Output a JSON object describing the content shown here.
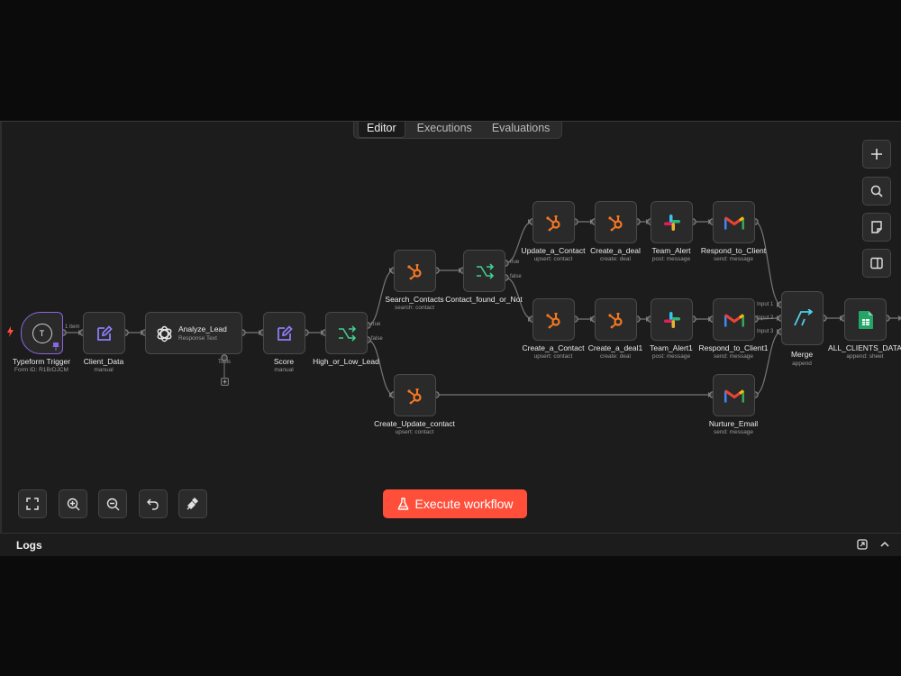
{
  "tabs": [
    "Editor",
    "Executions",
    "Evaluations"
  ],
  "active_tab": "Editor",
  "execute_label": "Execute workflow",
  "logs_title": "Logs",
  "conn_labels": {
    "items": "1 item",
    "tools": "Tools",
    "true1": "true",
    "false1": "false",
    "true2": "true",
    "false2": "false",
    "in1": "Input 1",
    "in2": "Input 2",
    "in3": "Input 3"
  },
  "nodes": {
    "typeform": {
      "label": "Typeform Trigger",
      "sub": "Form ID: R1BrDJCM",
      "icon": "typeform-icon",
      "letter": "T"
    },
    "client_data": {
      "label": "Client_Data",
      "sub": "manual",
      "icon": "edit-icon"
    },
    "analyze": {
      "label": "Analyze_Lead",
      "sub": "Response Text",
      "icon": "openai-icon"
    },
    "score": {
      "label": "Score",
      "sub": "manual",
      "icon": "edit-icon"
    },
    "high_low": {
      "label": "High_or_Low_Lead",
      "sub": "",
      "icon": "switch-icon"
    },
    "search": {
      "label": "Search_Contacts",
      "sub": "search: contact",
      "icon": "hubspot-icon"
    },
    "contact_found": {
      "label": "Contact_found_or_Not",
      "sub": "",
      "icon": "switch-icon"
    },
    "update": {
      "label": "Update_a_Contact",
      "sub": "upsert: contact",
      "icon": "hubspot-icon"
    },
    "deal": {
      "label": "Create_a_deal",
      "sub": "create: deal",
      "icon": "hubspot-icon"
    },
    "team_alert": {
      "label": "Team_Alert",
      "sub": "post: message",
      "icon": "slack-icon"
    },
    "respond": {
      "label": "Respond_to_Client",
      "sub": "send: message",
      "icon": "gmail-icon"
    },
    "create_contact": {
      "label": "Create_a_Contact",
      "sub": "upsert: contact",
      "icon": "hubspot-icon"
    },
    "deal1": {
      "label": "Create_a_deal1",
      "sub": "create: deal",
      "icon": "hubspot-icon"
    },
    "team_alert1": {
      "label": "Team_Alert1",
      "sub": "post: message",
      "icon": "slack-icon"
    },
    "respond1": {
      "label": "Respond_to_Client1",
      "sub": "send: message",
      "icon": "gmail-icon"
    },
    "merge": {
      "label": "Merge",
      "sub": "append",
      "icon": "merge-icon"
    },
    "sheets": {
      "label": "ALL_CLIENTS_DATA",
      "sub": "append: sheet",
      "icon": "google-sheets-icon"
    },
    "create_update": {
      "label": "Create_Update_contact",
      "sub": "upsert: contact",
      "icon": "hubspot-icon"
    },
    "nurture": {
      "label": "Nurture_Email",
      "sub": "send: message",
      "icon": "gmail-icon"
    }
  },
  "side_controls": [
    "plus-icon",
    "search-icon",
    "sticky-note-icon",
    "panel-icon"
  ],
  "bottom_controls": [
    "fit-view-icon",
    "zoom-in-icon",
    "zoom-out-icon",
    "undo-icon",
    "clean-up-icon"
  ],
  "colors": {
    "accent": "#ff4f3b",
    "hubspot": "#f57722",
    "switch": "#3fcf8e",
    "edit": "#8b7cf6",
    "merge": "#4fd1e8"
  }
}
